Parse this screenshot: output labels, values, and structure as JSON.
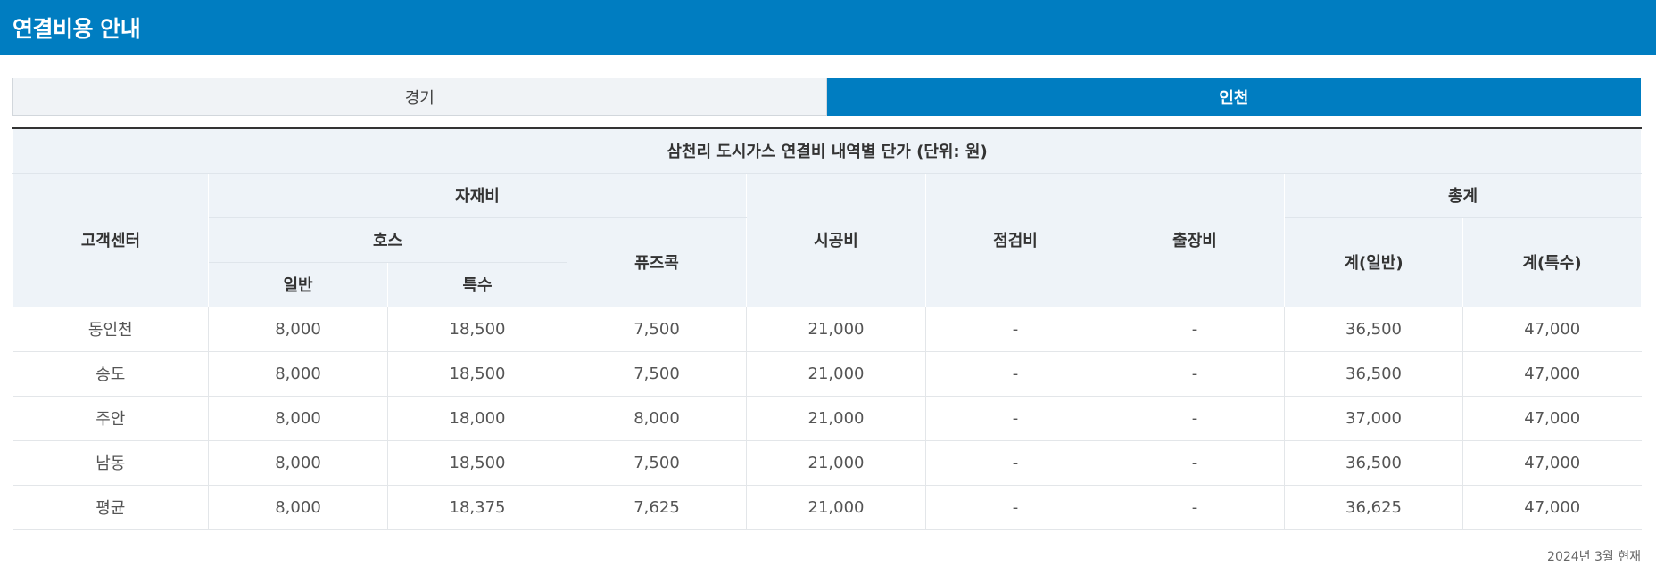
{
  "header": {
    "title": "연결비용 안내"
  },
  "tabs": [
    {
      "label": "경기",
      "active": false
    },
    {
      "label": "인천",
      "active": true
    }
  ],
  "table": {
    "caption": "삼천리 도시가스 연결비 내역별 단가 (단위: 원)",
    "headers": {
      "center": "고객센터",
      "materials": "자재비",
      "hose": "호스",
      "general": "일반",
      "special": "특수",
      "fusecock": "퓨즈콕",
      "construction": "시공비",
      "inspection": "점검비",
      "travel": "출장비",
      "total": "총계",
      "total_general": "계(일반)",
      "total_special": "계(특수)"
    },
    "rows": [
      [
        "동인천",
        "8,000",
        "18,500",
        "7,500",
        "21,000",
        "-",
        "-",
        "36,500",
        "47,000"
      ],
      [
        "송도",
        "8,000",
        "18,500",
        "7,500",
        "21,000",
        "-",
        "-",
        "36,500",
        "47,000"
      ],
      [
        "주안",
        "8,000",
        "18,000",
        "8,000",
        "21,000",
        "-",
        "-",
        "37,000",
        "47,000"
      ],
      [
        "남동",
        "8,000",
        "18,500",
        "7,500",
        "21,000",
        "-",
        "-",
        "36,500",
        "47,000"
      ],
      [
        "평균",
        "8,000",
        "18,375",
        "7,625",
        "21,000",
        "-",
        "-",
        "36,625",
        "47,000"
      ]
    ],
    "note": "2024년 3월 현재"
  },
  "colors": {
    "brand": "#007dc1",
    "header_bg": "#eef3f8"
  }
}
